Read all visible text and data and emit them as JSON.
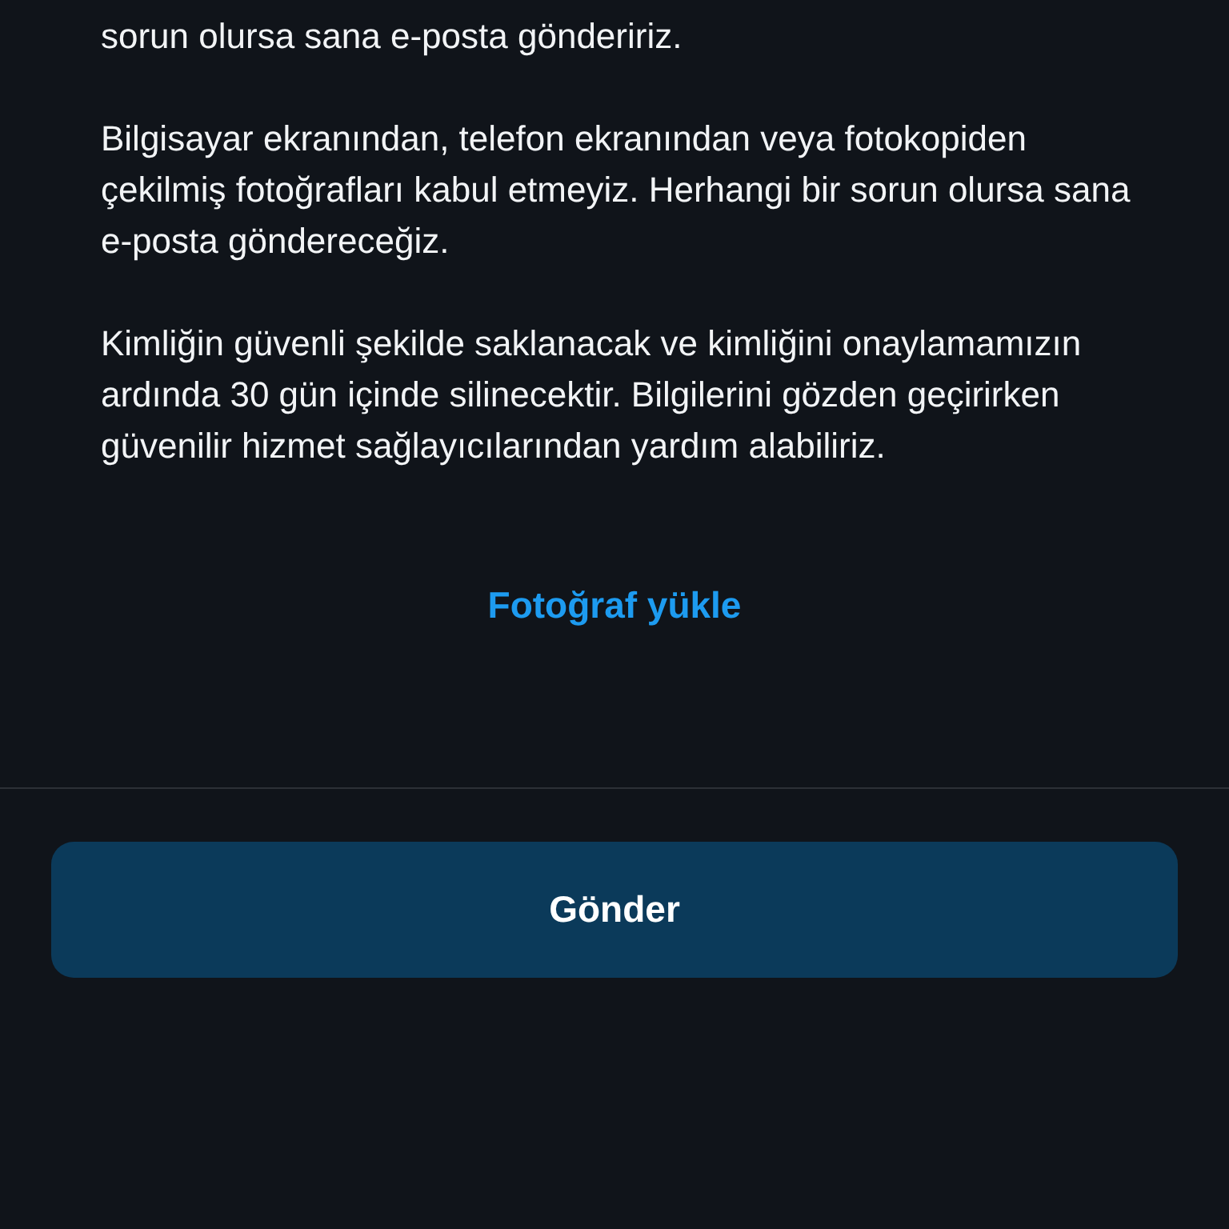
{
  "paragraphs": [
    "sorun olursa sana e-posta göndeririz.",
    "Bilgisayar ekranından, telefon ekranından veya fotokopiden çekilmiş fotoğrafları kabul etmeyiz. Herhangi bir sorun olursa sana e-posta göndereceğiz.",
    "Kimliğin güvenli şekilde saklanacak ve kimliğini onaylamamızın ardında 30 gün içinde silinecektir. Bilgilerini gözden geçirirken güvenilir hizmet sağlayıcılarından yardım alabiliriz."
  ],
  "upload_link": "Fotoğraf yükle",
  "submit_button": "Gönder"
}
